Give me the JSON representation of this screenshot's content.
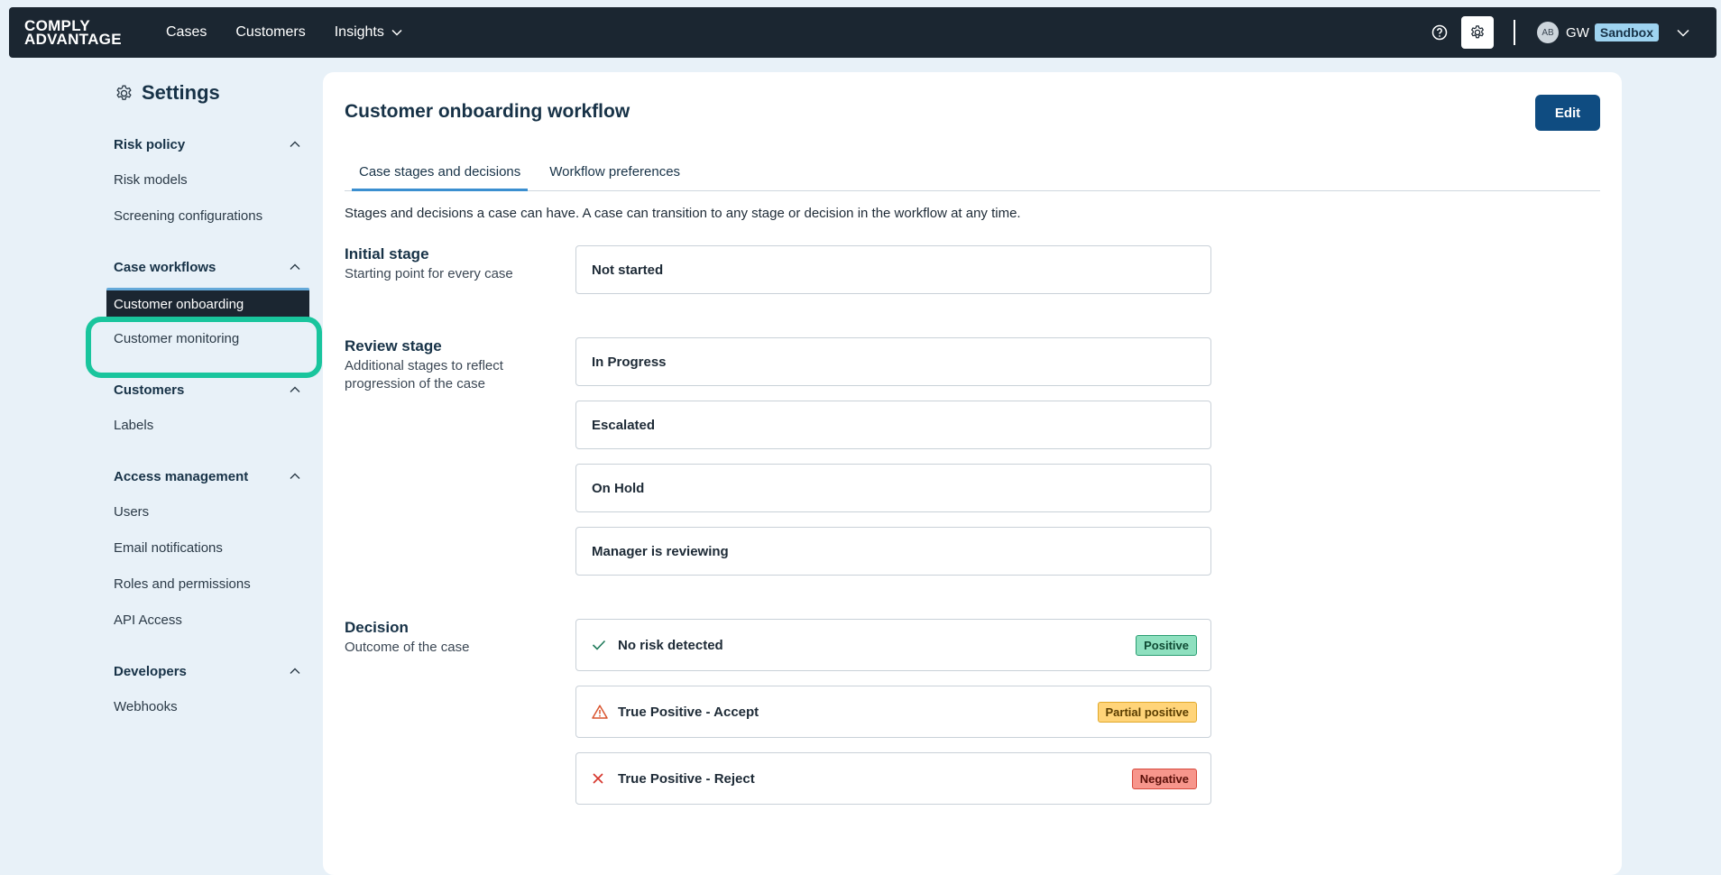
{
  "brand": {
    "line1": "COMPLY",
    "line2": "ADVANTAGE"
  },
  "nav": {
    "cases": "Cases",
    "customers": "Customers",
    "insights": "Insights"
  },
  "user": {
    "avatar": "AB",
    "initials": "GW",
    "environment": "Sandbox"
  },
  "sidebar": {
    "title": "Settings",
    "sections": [
      {
        "label": "Risk policy",
        "items": [
          "Risk models",
          "Screening configurations"
        ]
      },
      {
        "label": "Case workflows",
        "items": [
          "Customer onboarding",
          "Customer monitoring"
        ]
      },
      {
        "label": "Customers",
        "items": [
          "Labels"
        ]
      },
      {
        "label": "Access management",
        "items": [
          "Users",
          "Email notifications",
          "Roles and permissions",
          "API Access"
        ]
      },
      {
        "label": "Developers",
        "items": [
          "Webhooks"
        ]
      }
    ]
  },
  "main": {
    "title": "Customer onboarding workflow",
    "edit_label": "Edit",
    "tabs": [
      "Case stages and decisions",
      "Workflow preferences"
    ],
    "intro": "Stages and decisions a case can have. A case can transition to any stage or decision in the workflow at any time.",
    "initial": {
      "heading": "Initial stage",
      "desc": "Starting point for every case",
      "stages": [
        "Not started"
      ]
    },
    "review": {
      "heading": "Review stage",
      "desc": "Additional stages to reflect progression of the case",
      "stages": [
        "In Progress",
        "Escalated",
        "On Hold",
        "Manager is reviewing"
      ]
    },
    "decision": {
      "heading": "Decision",
      "desc": "Outcome of the case",
      "items": [
        {
          "label": "No risk detected",
          "badge": "Positive",
          "icon": "check-icon",
          "badge_bg": "#8ee0bf",
          "badge_border": "#2a9d72",
          "badge_color": "#0f4a33"
        },
        {
          "label": "True Positive - Accept",
          "badge": "Partial positive",
          "icon": "warning-icon",
          "badge_bg": "#ffd479",
          "badge_border": "#e0a82a",
          "badge_color": "#5a3d00"
        },
        {
          "label": "True Positive - Reject",
          "badge": "Negative",
          "icon": "x-icon",
          "badge_bg": "#f7968c",
          "badge_border": "#d6493c",
          "badge_color": "#5a0f08"
        }
      ]
    }
  },
  "colors": {
    "nav_bg": "#1b2631",
    "accent": "#0f4c81",
    "highlight": "#19c59d",
    "page_bg": "#e8f1f8"
  }
}
